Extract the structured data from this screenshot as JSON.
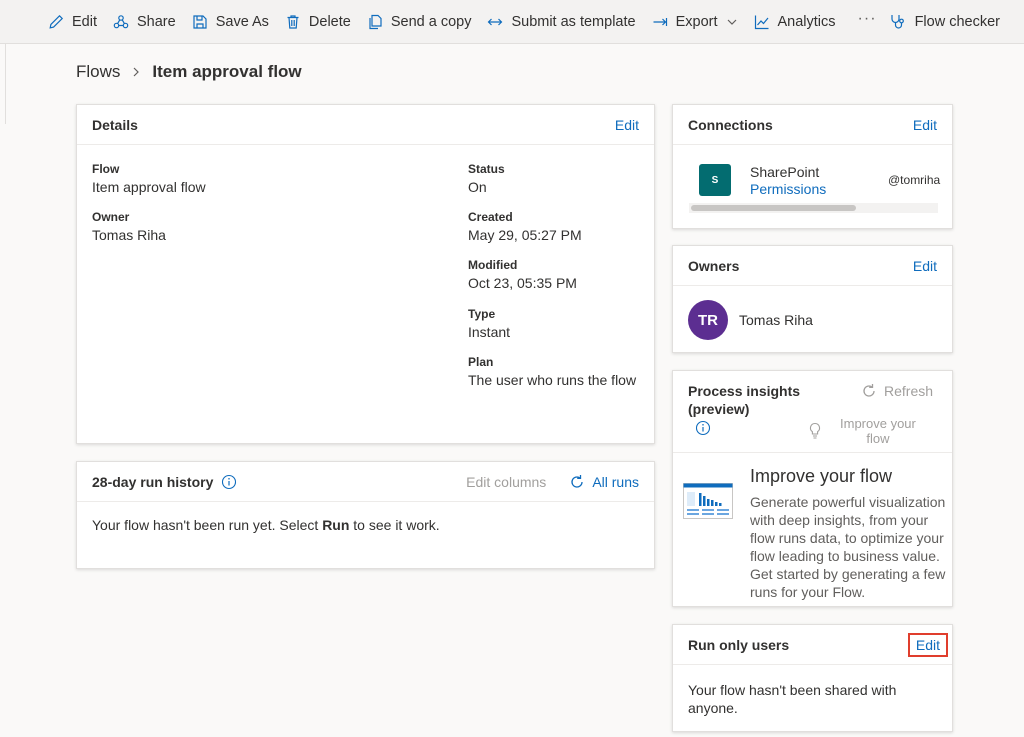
{
  "toolbar": {
    "edit": "Edit",
    "share": "Share",
    "save_as": "Save As",
    "delete": "Delete",
    "send_copy": "Send a copy",
    "submit_template": "Submit as template",
    "export": "Export",
    "analytics": "Analytics",
    "more": "···",
    "flow_checker": "Flow checker"
  },
  "breadcrumb": {
    "root": "Flows",
    "current": "Item approval flow"
  },
  "details": {
    "title": "Details",
    "edit": "Edit",
    "flow_label": "Flow",
    "flow_value": "Item approval flow",
    "owner_label": "Owner",
    "owner_value": "Tomas Riha",
    "status_label": "Status",
    "status_value": "On",
    "created_label": "Created",
    "created_value": "May 29, 05:27 PM",
    "modified_label": "Modified",
    "modified_value": "Oct 23, 05:35 PM",
    "type_label": "Type",
    "type_value": "Instant",
    "plan_label": "Plan",
    "plan_value": "The user who runs the flow"
  },
  "run_history": {
    "title": "28-day run history",
    "edit_columns": "Edit columns",
    "all_runs": "All runs",
    "message_before": "Your flow hasn't been run yet. Select ",
    "message_bold": "Run",
    "message_after": " to see it work."
  },
  "connections": {
    "title": "Connections",
    "edit": "Edit",
    "name": "SharePoint",
    "permissions": "Permissions",
    "account": "@tomriha",
    "icon_text": "S"
  },
  "owners": {
    "title": "Owners",
    "edit": "Edit",
    "initials": "TR",
    "name": "Tomas Riha"
  },
  "insights": {
    "title_line1": "Process insights",
    "title_line2": "(preview)",
    "refresh": "Refresh",
    "improve_line1": "Improve your",
    "improve_line2": "flow",
    "heading": "Improve your flow",
    "body": "Generate powerful visualization with deep insights, from your flow runs data, to optimize your flow leading to business value. Get started by generating a few runs for your Flow."
  },
  "run_only": {
    "title": "Run only users",
    "edit": "Edit",
    "message": "Your flow hasn't been shared with anyone."
  },
  "colors": {
    "accent": "#0f6cbd",
    "avatar": "#5c2e91",
    "sharepoint": "#036c70",
    "highlight": "#e03e2d"
  }
}
